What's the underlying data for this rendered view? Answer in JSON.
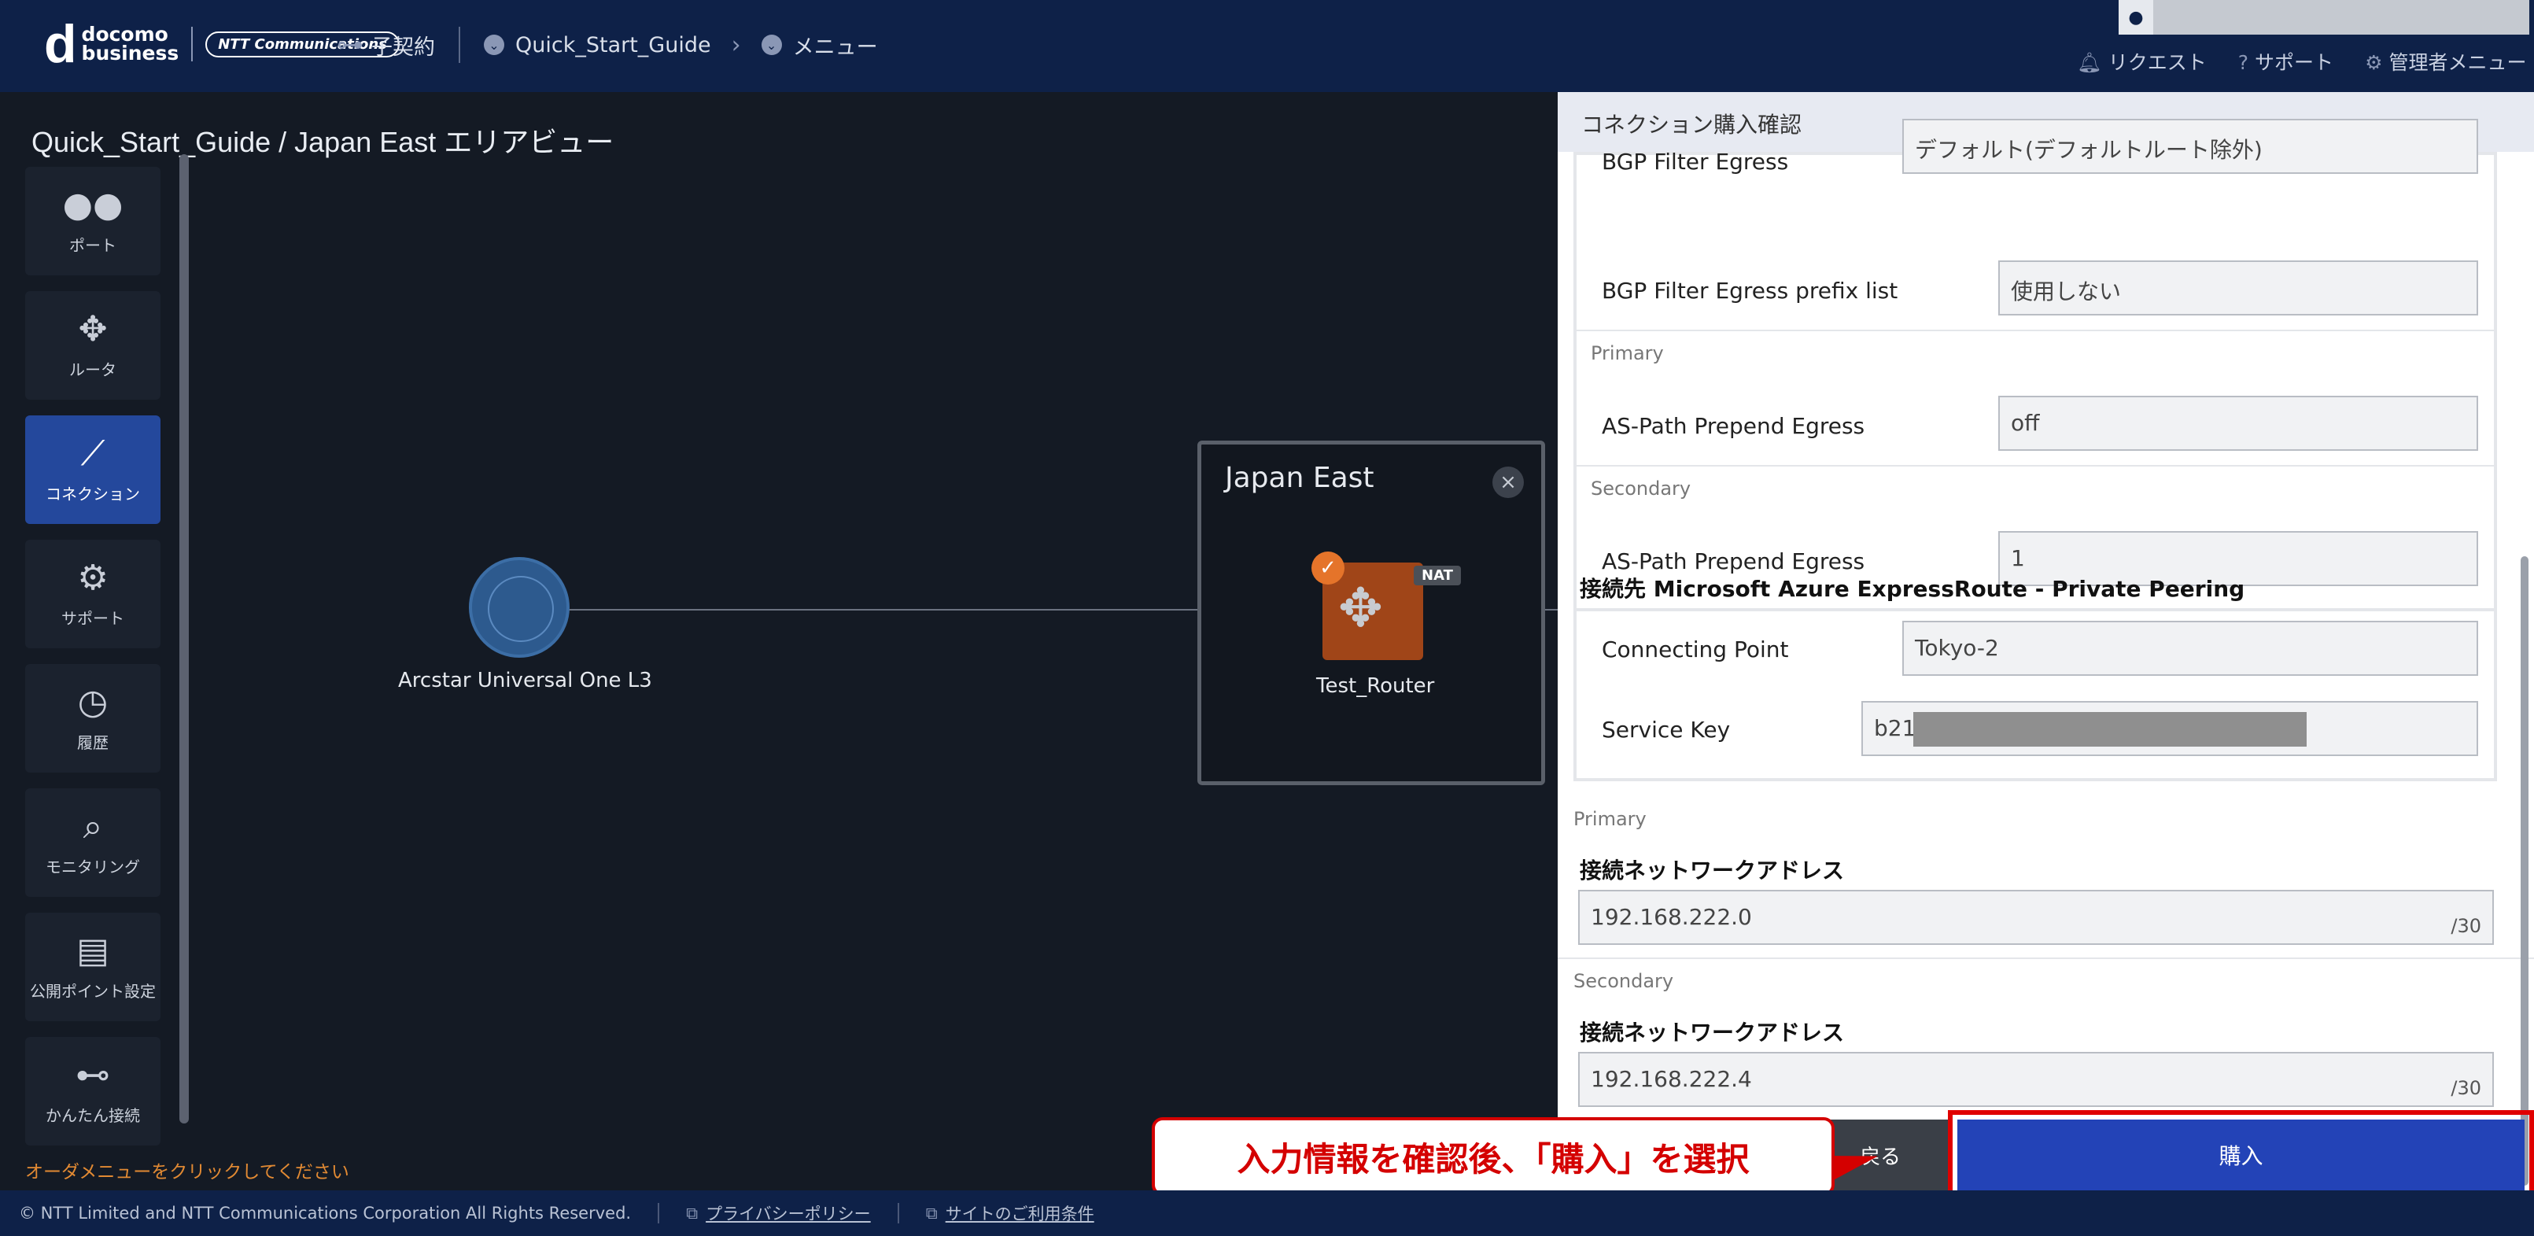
{
  "header": {
    "logo_top": "docomo",
    "logo_bottom": "business",
    "logo_ntt": "NTT Communications",
    "crumb_contract": "子契約",
    "crumb_guide": "Quick_Start_Guide",
    "crumb_menu": "メニュー",
    "user_name": "",
    "links": {
      "request": "リクエスト",
      "support": "サポート",
      "admin": "管理者メニュー"
    }
  },
  "page_title": "Quick_Start_Guide / Japan East エリアビュー",
  "sidebar": {
    "items": [
      {
        "label": "ポート",
        "icon": "port-icon"
      },
      {
        "label": "ルータ",
        "icon": "router-icon"
      },
      {
        "label": "コネクション",
        "icon": "connection-icon"
      },
      {
        "label": "サポート",
        "icon": "support-icon"
      },
      {
        "label": "履歴",
        "icon": "history-icon"
      },
      {
        "label": "モニタリング",
        "icon": "monitoring-icon"
      },
      {
        "label": "公開ポイント設定",
        "icon": "publish-point-icon"
      },
      {
        "label": "かんたん接続",
        "icon": "easy-connect-icon"
      }
    ],
    "order_hint": "オーダメニューをクリックしてください"
  },
  "canvas": {
    "network_label": "Arcstar Universal One L3",
    "area_title": "Japan East",
    "router_label": "Test_Router",
    "nat_badge": "NAT"
  },
  "panel": {
    "title": "コネクション購入確認",
    "bgp_egress_label": "BGP Filter Egress",
    "bgp_egress_value": "デフォルト(デフォルトルート除外)",
    "bgp_prefix_label": "BGP Filter Egress prefix list",
    "bgp_prefix_value": "使用しない",
    "primary": "Primary",
    "secondary": "Secondary",
    "as_path_label": "AS-Path Prepend Egress",
    "as_path_primary": "off",
    "as_path_secondary": "1",
    "dest_title": "接続先 Microsoft Azure ExpressRoute - Private Peering",
    "connecting_point_label": "Connecting Point",
    "connecting_point_value": "Tokyo-2",
    "service_key_label": "Service Key",
    "service_key_value": "b21",
    "net_addr_label": "接続ネットワークアドレス",
    "primary_addr": "192.168.222.0",
    "secondary_addr": "192.168.222.4",
    "prefix": "/30"
  },
  "actions": {
    "back": "戻る",
    "buy": "購入",
    "callout": "入力情報を確認後、「購入」を選択"
  },
  "footer": {
    "copyright": "© NTT Limited and NTT Communications Corporation All Rights Reserved.",
    "privacy": "プライバシーポリシー",
    "terms": "サイトのご利用条件"
  }
}
